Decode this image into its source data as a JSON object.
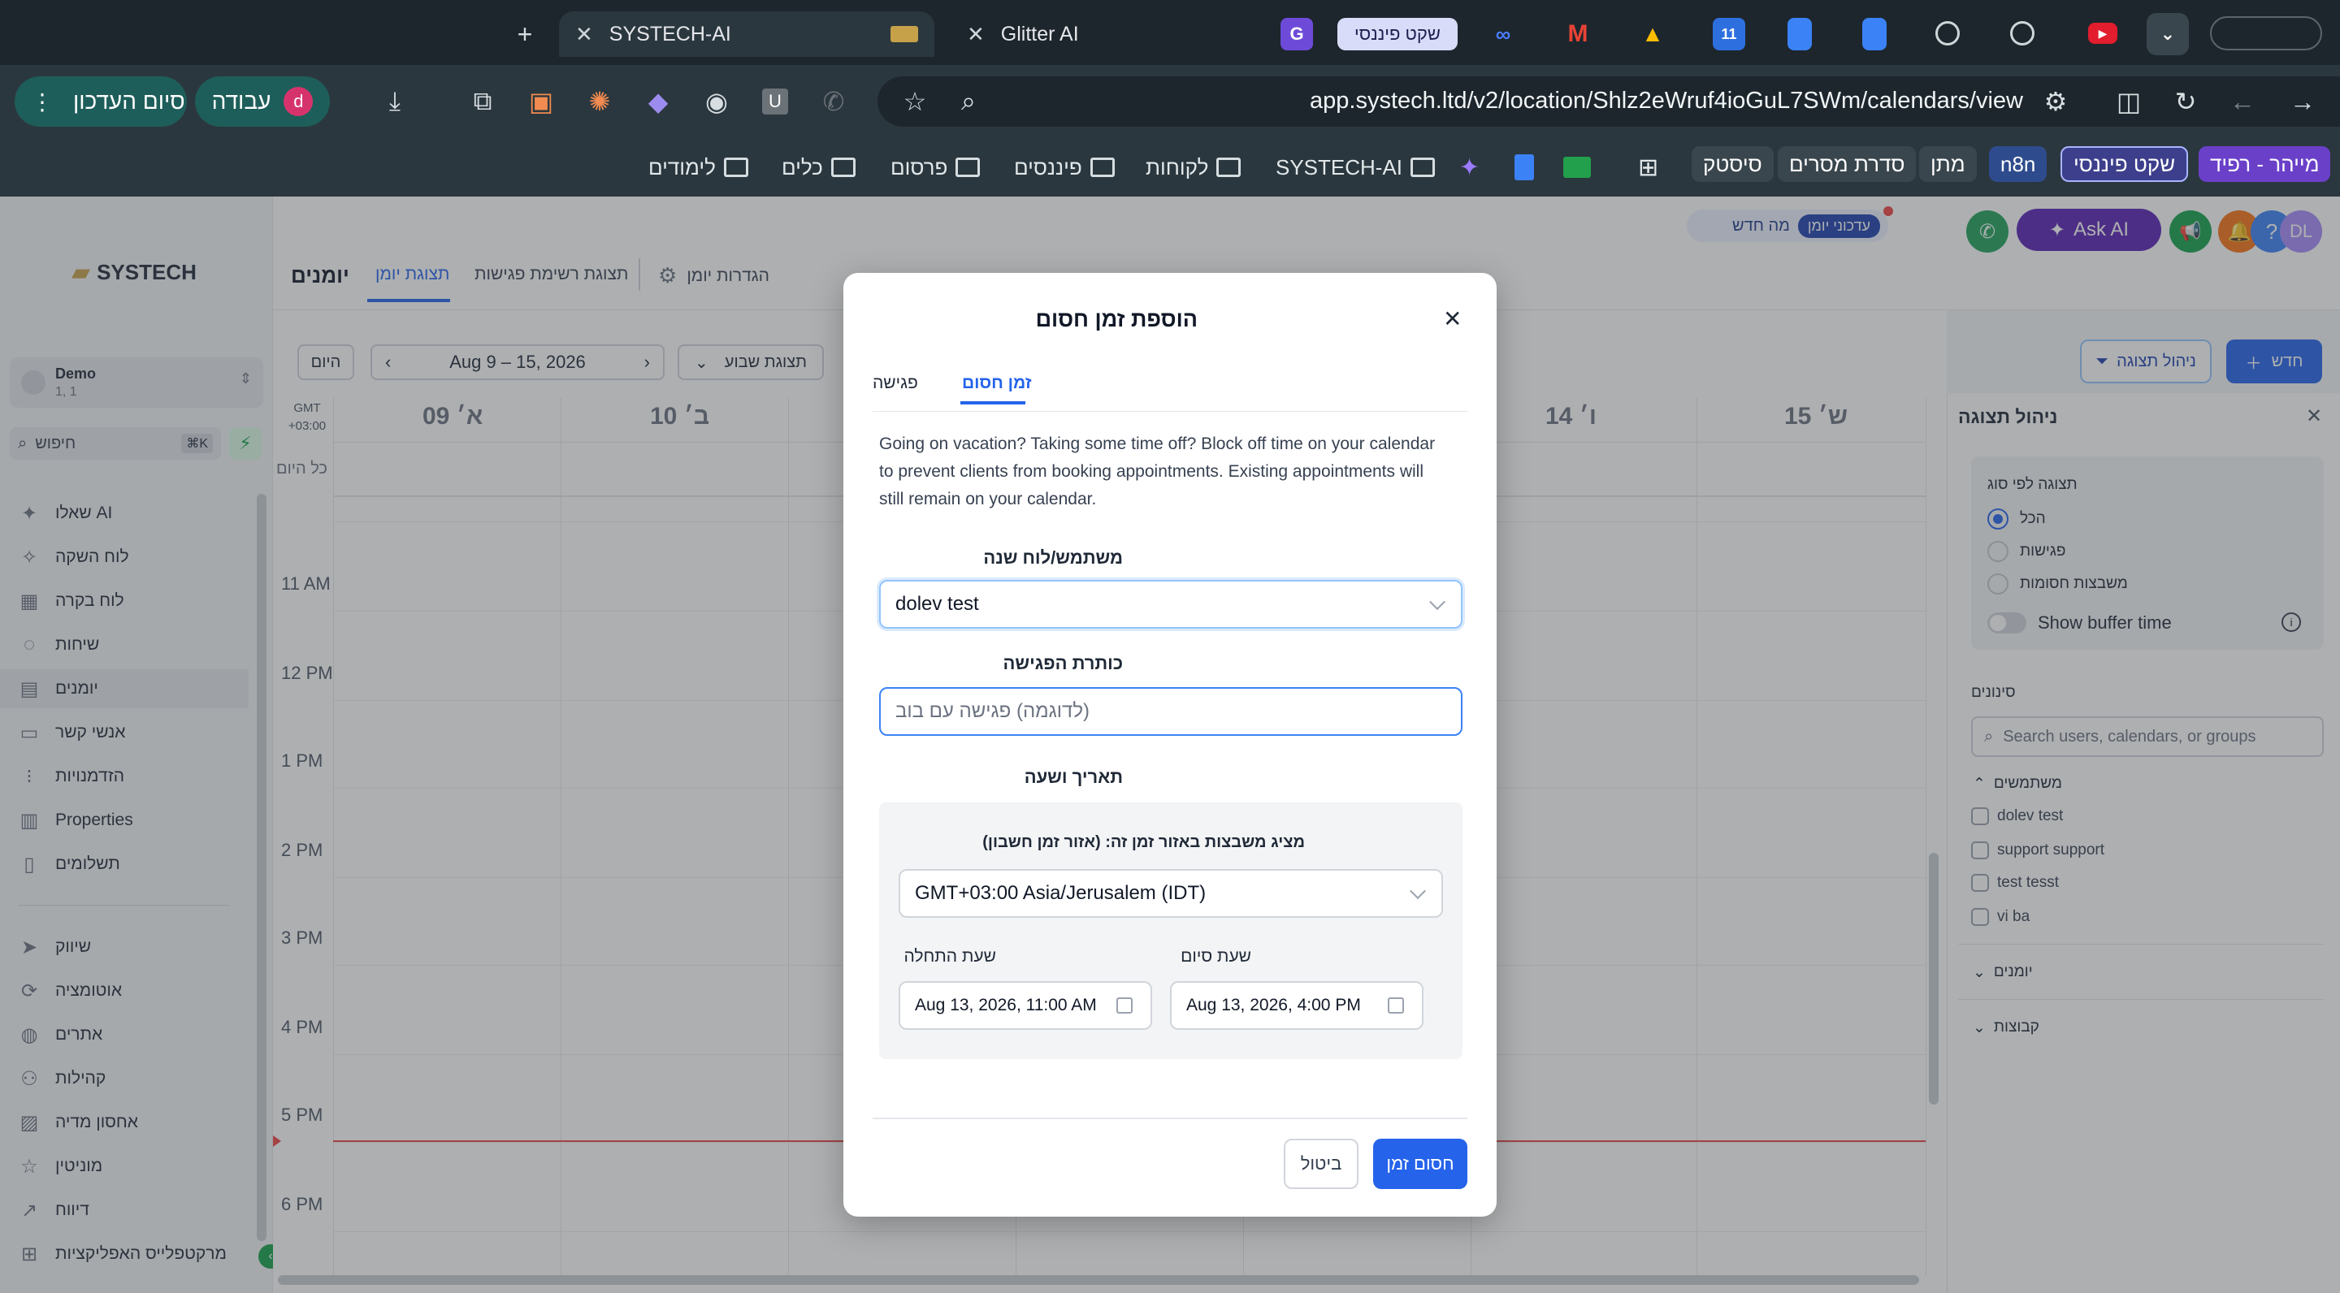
{
  "tabs": {
    "new_tab": "+",
    "active": "SYSTECH-AI",
    "other": "Glitter AI",
    "pinned_badge": "שקט פיננסי",
    "pinned_calendar": "11"
  },
  "toolbar": {
    "finish_update": "סיום העדכון",
    "work_profile": "עבודה",
    "profile_initial": "d",
    "url": "app.systech.ltd/v2/location/Shlz2eWruf4ioGuL7SWm/calendars/view",
    "ext_u": "U"
  },
  "bookmarks": {
    "items": [
      "מייהר - רפיד",
      "שקט פיננסי",
      "n8n",
      "מתן",
      "סדרת מסרים",
      "סיסטק",
      "SYSTECH-AI",
      "לקוחות",
      "פיננסים",
      "פרסום",
      "כלים",
      "לימודים"
    ]
  },
  "header": {
    "logo": "SYSTECH",
    "tabs": [
      "יומנים",
      "תצוגת יומן",
      "תצוגת רשימת פגישות",
      "הגדרות יומן"
    ],
    "notifications_badge": "עדכוני יומן",
    "whats_new": "מה חדש",
    "ask_ai": "Ask AI",
    "help": "?",
    "avatar": "DL"
  },
  "sidebar": {
    "account_name": "Demo",
    "account_sub": "1, 1",
    "search_placeholder": "חיפוש",
    "search_shortcut": "⌘K",
    "items": [
      {
        "label": "שאלו AI",
        "icon": "sparkle-icon"
      },
      {
        "label": "לוח השקה",
        "icon": "rocket-icon"
      },
      {
        "label": "לוח בקרה",
        "icon": "grid-icon"
      },
      {
        "label": "שיחות",
        "icon": "chat-icon"
      },
      {
        "label": "יומנים",
        "icon": "calendar-icon"
      },
      {
        "label": "אנשי קשר",
        "icon": "contacts-icon"
      },
      {
        "label": "הזדמנויות",
        "icon": "pipeline-icon"
      },
      {
        "label": "Properties",
        "icon": "building-icon"
      },
      {
        "label": "תשלומים",
        "icon": "receipt-icon"
      },
      {
        "label": "שיווק",
        "icon": "send-icon"
      },
      {
        "label": "אוטומציה",
        "icon": "automation-icon"
      },
      {
        "label": "אתרים",
        "icon": "globe-icon"
      },
      {
        "label": "קהילות",
        "icon": "community-icon"
      },
      {
        "label": "אחסון מדיה",
        "icon": "image-icon"
      },
      {
        "label": "מוניטין",
        "icon": "star-icon"
      },
      {
        "label": "דיווח",
        "icon": "trend-icon"
      },
      {
        "label": "מרקטפלייס האפליקציות",
        "icon": "apps-icon"
      }
    ]
  },
  "calendar": {
    "today_button": "היום",
    "range": "Aug 9 – 15, 2026",
    "view_select": "תצוגת שבוע",
    "manage_view": "ניהול תצוגה",
    "new_button": "חדש",
    "tz_label": "GMT +03:00",
    "all_day": "כל היום",
    "days": [
      "09 א׳",
      "10 ב׳",
      "14 ו׳",
      "15 ש׳"
    ],
    "hours": [
      "11 AM",
      "12 PM",
      "1 PM",
      "2 PM",
      "3 PM",
      "4 PM",
      "5 PM",
      "6 PM"
    ]
  },
  "right_panel": {
    "title": "ניהול תצוגה",
    "filter_title": "תצוגה לפי סוג",
    "options": [
      "הכל",
      "פגישות",
      "משבצות חסומות"
    ],
    "selected": "הכל",
    "buffer_label": "Show buffer time",
    "filters_title": "סינונים",
    "search_placeholder": "Search users, calendars, or groups",
    "users_title": "משתמשים",
    "users": [
      "dolev test",
      "support support",
      "test tesst",
      "vi ba"
    ],
    "calendars_title": "יומנים",
    "groups_title": "קבוצות"
  },
  "modal": {
    "title": "הוספת זמן חסום",
    "tabs": [
      "זמן חסום",
      "פגישה"
    ],
    "active_tab": "זמן חסום",
    "description": "Going on vacation? Taking some time off? Block off time on your calendar to prevent clients from booking appointments. Existing appointments will still remain on your calendar.",
    "user_label": "משתמש/לוח שנה",
    "user_value": "dolev test",
    "title_label": "כותרת הפגישה",
    "title_placeholder": "(לדוגמה) פגישה עם בוב",
    "datetime_label": "תאריך ושעה",
    "tz_label": "מציג משבצות באזור זמן זה: (אזור זמן חשבון)",
    "tz_value": "GMT+03:00 Asia/Jerusalem (IDT)",
    "start_label": "שעת התחלה",
    "start_value": "Aug 13, 2026, 11:00 AM",
    "end_label": "שעת סיום",
    "end_value": "Aug 13, 2026, 4:00 PM",
    "cancel": "ביטול",
    "submit": "חסום זמן"
  },
  "colors": {
    "primary": "#2563eb",
    "chrome_bg": "#2b373e",
    "now_line": "#ef4444"
  }
}
